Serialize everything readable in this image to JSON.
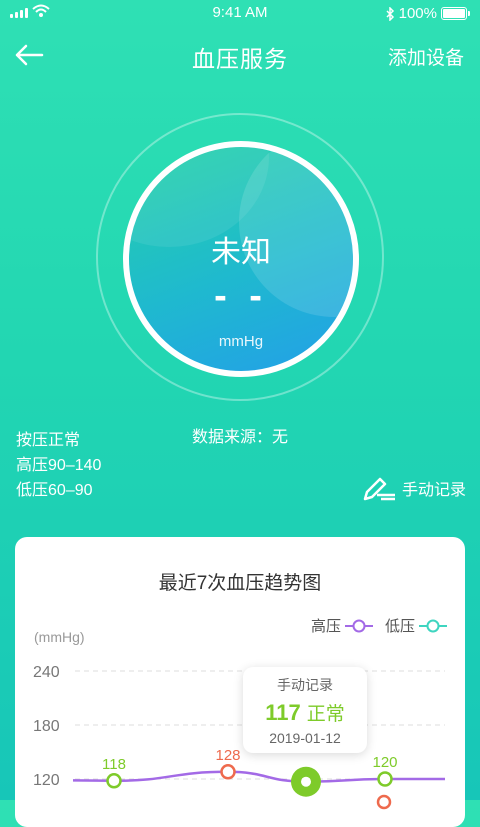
{
  "status_bar": {
    "time": "9:41 AM",
    "battery": "100%"
  },
  "nav": {
    "title": "血压服务",
    "add_device": "添加设备"
  },
  "gauge": {
    "status": "未知",
    "value": "- -",
    "unit": "mmHg"
  },
  "source": "数据来源：无",
  "info": [
    "按压正常",
    "高压90–140",
    "低压60–90"
  ],
  "manual_record": "手动记录",
  "card": {
    "title": "最近7次血压趋势图",
    "legend": {
      "high": "高压",
      "low": "低压"
    },
    "unit": "(mmHg)",
    "tooltip": {
      "label": "手动记录",
      "value": "117",
      "status": "正常",
      "date": "2019-01-12"
    }
  },
  "colors": {
    "high": "#a36ae6",
    "low": "#3fd5c0",
    "normal_point": "#7ecb2a",
    "high_point": "#ee6a4d"
  },
  "chart_data": {
    "type": "line",
    "ylabel": "(mmHg)",
    "y_ticks": [
      120,
      180,
      240
    ],
    "series": [
      {
        "name": "高压",
        "x": [
          0,
          1,
          2,
          3,
          4
        ],
        "values": [
          118,
          128,
          117,
          120,
          120
        ]
      }
    ],
    "data_labels": [
      {
        "x": 0,
        "value": 118,
        "text": "118",
        "color": "#7ecb2a"
      },
      {
        "x": 1,
        "value": 128,
        "text": "128",
        "color": "#ee6a4d"
      },
      {
        "x": 3,
        "value": 120,
        "text": "120",
        "color": "#7ecb2a"
      }
    ]
  }
}
